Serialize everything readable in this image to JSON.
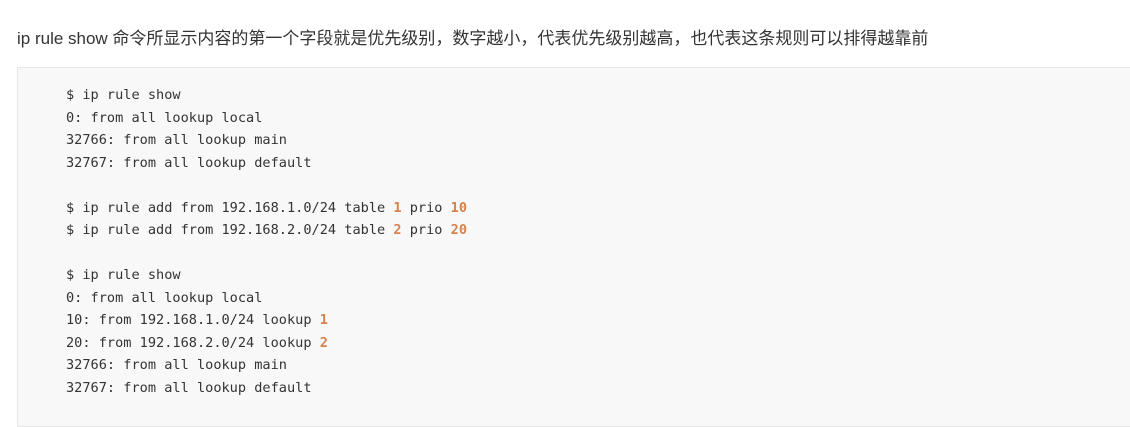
{
  "intro": "ip rule show 命令所显示内容的第一个字段就是优先级别，数字越小，代表优先级别越高，也代表这条规则可以排得越靠前",
  "colors": {
    "number": "#d7814b",
    "code_bg": "#f8f8f8"
  },
  "code_lines": [
    [
      {
        "t": "$ ip rule show"
      }
    ],
    [
      {
        "t": "0: from all lookup local"
      }
    ],
    [
      {
        "t": "32766: from all lookup main"
      }
    ],
    [
      {
        "t": "32767: from all lookup default"
      }
    ],
    [],
    [
      {
        "t": "$ ip rule add from 192.168.1.0/24 table "
      },
      {
        "t": "1",
        "n": true
      },
      {
        "t": " prio "
      },
      {
        "t": "10",
        "n": true
      }
    ],
    [
      {
        "t": "$ ip rule add from 192.168.2.0/24 table "
      },
      {
        "t": "2",
        "n": true
      },
      {
        "t": " prio "
      },
      {
        "t": "20",
        "n": true
      }
    ],
    [],
    [
      {
        "t": "$ ip rule show"
      }
    ],
    [
      {
        "t": "0: from all lookup local"
      }
    ],
    [
      {
        "t": "10: from 192.168.1.0/24 lookup "
      },
      {
        "t": "1",
        "n": true
      }
    ],
    [
      {
        "t": "20: from 192.168.2.0/24 lookup "
      },
      {
        "t": "2",
        "n": true
      }
    ],
    [
      {
        "t": "32766: from all lookup main"
      }
    ],
    [
      {
        "t": "32767: from all lookup default"
      }
    ]
  ]
}
